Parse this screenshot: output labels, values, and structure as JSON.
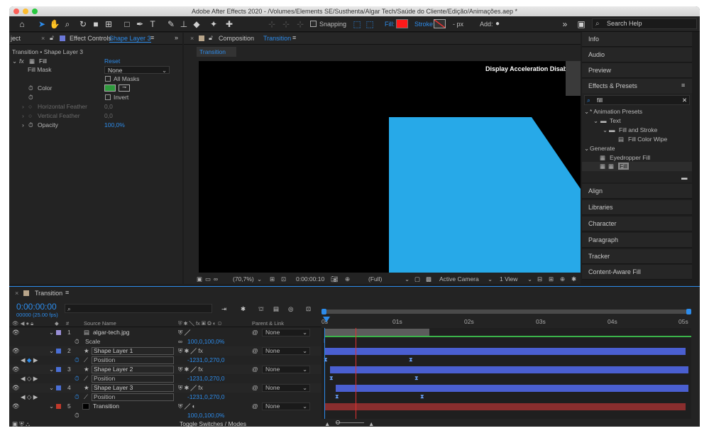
{
  "titlebar": {
    "title": "Adobe After Effects 2020 - /Volumes/Elements SE/Susthenta/Algar Tech/Saúde do Cliente/Edição/Animações.aep *"
  },
  "toolbar": {
    "snapping_label": "Snapping",
    "fill_label": "Fill:",
    "stroke_label": "Stroke:",
    "stroke_px": "- px",
    "add_label": "Add:",
    "search_placeholder": "Search Help",
    "fill_color": "#ff1a1a"
  },
  "effect_controls": {
    "tab_project": "ject",
    "tab_label": "Effect Controls",
    "tab_layer": "Shape Layer 3",
    "subtitle": "Transition • Shape Layer 3",
    "effect_name": "Fill",
    "reset": "Reset",
    "fill_mask_label": "Fill Mask",
    "fill_mask_value": "None",
    "all_masks": "All Masks",
    "color_label": "Color",
    "color_value": "#2e9a3c",
    "invert": "Invert",
    "h_feather_label": "Horizontal Feather",
    "h_feather_value": "0,0",
    "v_feather_label": "Vertical Feather",
    "v_feather_value": "0,0",
    "opacity_label": "Opacity",
    "opacity_value": "100,0%"
  },
  "composition": {
    "tab_label": "Composition",
    "tab_name": "Transition",
    "sub_tab": "Transition",
    "warning": "Display Acceleration Disable",
    "zoom": "(70,7%)",
    "timecode": "0:00:00:10",
    "resolution": "(Full)",
    "camera": "Active Camera",
    "views": "1 View",
    "shape_color": "#27a9e8"
  },
  "right_panel": {
    "items_top": [
      "Info",
      "Audio",
      "Preview"
    ],
    "effects_title": "Effects & Presets",
    "search_value": "fill",
    "tree": {
      "animation_presets": "* Animation Presets",
      "text": "Text",
      "fill_and_stroke": "Fill and Stroke",
      "fill_color_wipe": "Fill Color Wipe",
      "generate": "Generate",
      "eyedropper_fill": "Eyedropper Fill",
      "fill": "Fill"
    },
    "items_bottom": [
      "Align",
      "Libraries",
      "Character",
      "Paragraph",
      "Tracker",
      "Content-Aware Fill"
    ]
  },
  "timeline": {
    "tab_name": "Transition",
    "timecode": "0:00:00:00",
    "fps": "00000 (25.00 fps)",
    "col_num": "#",
    "col_source": "Source Name",
    "col_parent": "Parent & Link",
    "ruler": [
      "0s",
      "01s",
      "02s",
      "03s",
      "04s",
      "05s"
    ],
    "toggle_label": "Toggle Switches / Modes",
    "rows": [
      {
        "num": "1",
        "name": "algar-tech.jpg",
        "parent": "None",
        "label_color": "#9a8fd6"
      },
      {
        "sub": "Scale",
        "value": "100,0,100,0%"
      },
      {
        "num": "2",
        "name": "Shape Layer 1",
        "parent": "None",
        "label_color": "#4a6fd6"
      },
      {
        "sub": "Position",
        "value": "-1231,0,270,0"
      },
      {
        "num": "3",
        "name": "Shape Layer 2",
        "parent": "None",
        "label_color": "#4a6fd6"
      },
      {
        "sub": "Position",
        "value": "-1231,0,270,0"
      },
      {
        "num": "4",
        "name": "Shape Layer 3",
        "parent": "None",
        "label_color": "#4a6fd6"
      },
      {
        "sub": "Position",
        "value": "-1231,0,270,0"
      },
      {
        "num": "5",
        "name": "Transition",
        "parent": "None",
        "label_color": "#c0392b"
      },
      {
        "sub": "",
        "value": "100,0,100,0%"
      }
    ]
  }
}
